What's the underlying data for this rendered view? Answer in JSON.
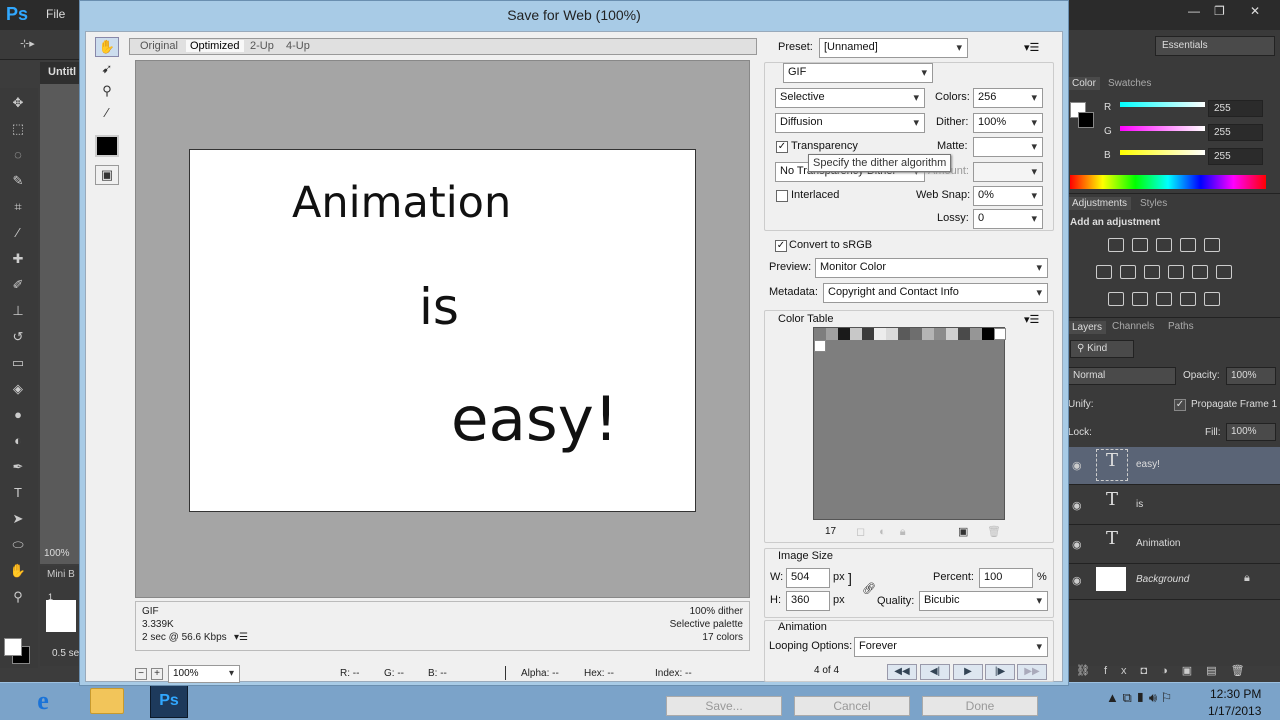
{
  "ps": {
    "logo": "Ps",
    "menu_file": "File",
    "doc_tab": "Untitl",
    "zoom": "100%",
    "mini_bridge": "Mini B",
    "frame_number": "1",
    "frame_delay": "0.5 se",
    "workspace": "Essentials"
  },
  "color_panel": {
    "tabs": [
      "Color",
      "Swatches"
    ],
    "r_label": "R",
    "g_label": "G",
    "b_label": "B",
    "r": "255",
    "g": "255",
    "b": "255"
  },
  "adjustments": {
    "tabs": [
      "Adjustments",
      "Styles"
    ],
    "title": "Add an adjustment"
  },
  "layers": {
    "tabs": [
      "Layers",
      "Channels",
      "Paths"
    ],
    "filter": "Kind",
    "blend_mode": "Normal",
    "opacity_label": "Opacity:",
    "opacity": "100%",
    "unify_label": "Unify:",
    "propagate": "Propagate Frame 1",
    "lock_label": "Lock:",
    "fill_label": "Fill:",
    "fill": "100%",
    "items": [
      {
        "name": "easy!",
        "thumb": "T"
      },
      {
        "name": "is",
        "thumb": "T"
      },
      {
        "name": "Animation",
        "thumb": "T"
      },
      {
        "name": "Background",
        "thumb": ""
      }
    ]
  },
  "dialog": {
    "title": "Save for Web (100%)",
    "view_tabs": [
      "Original",
      "Optimized",
      "2-Up",
      "4-Up"
    ],
    "image_text": [
      "Animation",
      "is",
      "easy!"
    ],
    "info_left": [
      "GIF",
      "3.339K",
      "2 sec @ 56.6 Kbps"
    ],
    "info_right": [
      "100% dither",
      "Selective palette",
      "17 colors"
    ],
    "status_zoom": "100%",
    "status": {
      "r": "R: --",
      "g": "G: --",
      "b": "B: --",
      "alpha": "Alpha: --",
      "hex": "Hex: --",
      "index": "Index: --"
    },
    "preset_label": "Preset:",
    "preset": "[Unnamed]",
    "format": "GIF",
    "reduction": "Selective",
    "colors_label": "Colors:",
    "colors": "256",
    "dither_algo": "Diffusion",
    "dither_label": "Dither:",
    "dither": "100%",
    "transparency_label": "Transparency",
    "matte_label": "Matte:",
    "matte": "",
    "transparency_dither": "No Transparency Dither",
    "amount_label": "Amount:",
    "amount": "",
    "tooltip": "Specify the dither algorithm",
    "interlaced_label": "Interlaced",
    "websnap_label": "Web Snap:",
    "websnap": "0%",
    "lossy_label": "Lossy:",
    "lossy": "0",
    "convert_srgb_label": "Convert to sRGB",
    "preview_label": "Preview:",
    "preview": "Monitor Color",
    "metadata_label": "Metadata:",
    "metadata": "Copyright and Contact Info",
    "color_table_title": "Color Table",
    "color_count": "17",
    "image_size_title": "Image Size",
    "w_label": "W:",
    "w": "504",
    "h_label": "H:",
    "h": "360",
    "px": "px",
    "percent_label": "Percent:",
    "percent": "100",
    "percent_unit": "%",
    "quality_label": "Quality:",
    "quality": "Bicubic",
    "animation_title": "Animation",
    "looping_label": "Looping Options:",
    "looping": "Forever",
    "frame_counter": "4 of 4",
    "save": "Save...",
    "cancel": "Cancel",
    "done": "Done"
  },
  "taskbar": {
    "ps_label": "Ps",
    "time": "12:30 PM",
    "date": "1/17/2013"
  },
  "colors": {
    "ps_blue": "#31a8ff",
    "layer_selected": "#5a6476",
    "dialog_frame": "#a8cbe6"
  }
}
